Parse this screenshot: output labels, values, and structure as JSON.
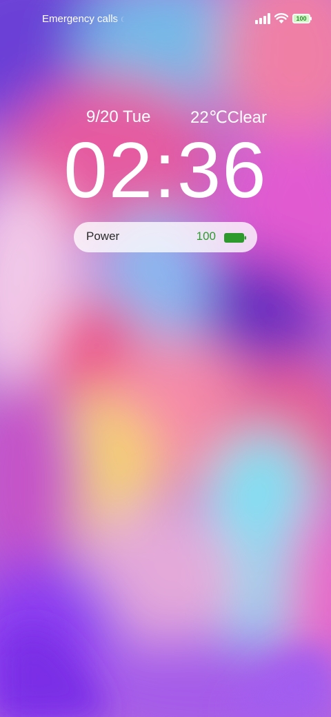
{
  "status_bar": {
    "carrier_text": "Emergency calls only",
    "battery_level": "100",
    "icons": [
      "signal-icon",
      "wifi-icon",
      "battery-icon"
    ]
  },
  "lockscreen": {
    "date": "9/20 Tue",
    "weather": "22℃Clear",
    "time": "02:36"
  },
  "power_widget": {
    "label": "Power",
    "value": "100",
    "fill_fraction": 1.0,
    "color": "#2e9a2e"
  }
}
